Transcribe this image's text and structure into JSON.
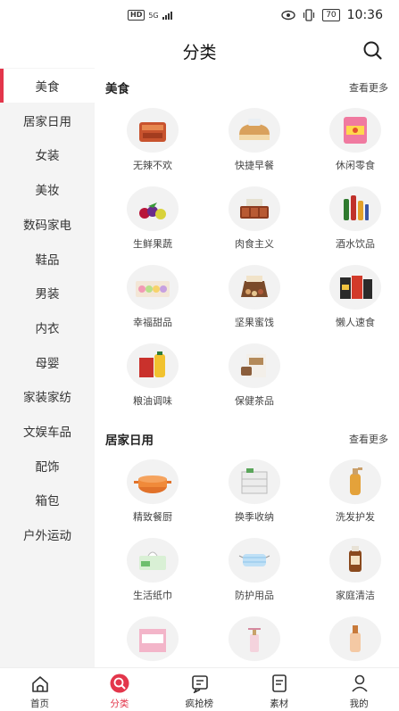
{
  "status_bar": {
    "hd": "HD",
    "network": "5G",
    "battery": "70",
    "time": "10:36"
  },
  "header": {
    "title": "分类"
  },
  "sidebar": {
    "items": [
      {
        "label": "美食",
        "active": true
      },
      {
        "label": "居家日用"
      },
      {
        "label": "女装"
      },
      {
        "label": "美妆"
      },
      {
        "label": "数码家电"
      },
      {
        "label": "鞋品"
      },
      {
        "label": "男装"
      },
      {
        "label": "内衣"
      },
      {
        "label": "母婴"
      },
      {
        "label": "家装家纺"
      },
      {
        "label": "文娱车品"
      },
      {
        "label": "配饰"
      },
      {
        "label": "箱包"
      },
      {
        "label": "户外运动"
      }
    ]
  },
  "sections": [
    {
      "title": "美食",
      "more": "查看更多",
      "items": [
        {
          "label": "无辣不欢",
          "icon": "spicy-snack-icon"
        },
        {
          "label": "快捷早餐",
          "icon": "bread-icon"
        },
        {
          "label": "休闲零食",
          "icon": "snack-bag-icon"
        },
        {
          "label": "生鲜果蔬",
          "icon": "fruit-icon"
        },
        {
          "label": "肉食主义",
          "icon": "meat-icon"
        },
        {
          "label": "酒水饮品",
          "icon": "drinks-icon"
        },
        {
          "label": "幸福甜品",
          "icon": "macaron-icon"
        },
        {
          "label": "坚果蜜饯",
          "icon": "nuts-icon"
        },
        {
          "label": "懒人速食",
          "icon": "instant-food-icon"
        },
        {
          "label": "粮油调味",
          "icon": "oil-rice-icon"
        },
        {
          "label": "保健茶品",
          "icon": "tea-icon"
        }
      ]
    },
    {
      "title": "居家日用",
      "more": "查看更多",
      "items": [
        {
          "label": "精致餐厨",
          "icon": "pot-icon"
        },
        {
          "label": "换季收纳",
          "icon": "storage-box-icon"
        },
        {
          "label": "洗发护发",
          "icon": "shampoo-icon"
        },
        {
          "label": "生活纸巾",
          "icon": "tissue-icon"
        },
        {
          "label": "防护用品",
          "icon": "mask-icon"
        },
        {
          "label": "家庭清洁",
          "icon": "cleaner-icon"
        },
        {
          "label": "",
          "icon": "pad-icon"
        },
        {
          "label": "",
          "icon": "fragrance-icon"
        },
        {
          "label": "",
          "icon": "lotion-icon"
        }
      ]
    }
  ],
  "bottom_nav": [
    {
      "label": "首页",
      "icon": "home-icon"
    },
    {
      "label": "分类",
      "icon": "category-icon",
      "active": true
    },
    {
      "label": "疯抢榜",
      "icon": "ranking-icon"
    },
    {
      "label": "素材",
      "icon": "material-icon"
    },
    {
      "label": "我的",
      "icon": "profile-icon"
    }
  ],
  "colors": {
    "accent": "#e3364b",
    "sidebar_bg": "#f4f4f4"
  }
}
